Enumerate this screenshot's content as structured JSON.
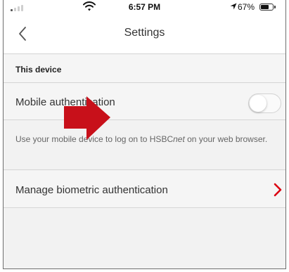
{
  "status_bar": {
    "time": "6:57 PM",
    "battery_pct": "67%",
    "battery_level": 0.67
  },
  "nav": {
    "title": "Settings",
    "back_icon": "chevron-left-icon"
  },
  "section": {
    "title": "This device"
  },
  "mobile_auth": {
    "label": "Mobile authentication",
    "enabled": false,
    "description_prefix": "Use your mobile device to log on to HSBC",
    "description_brand_suffix": "net",
    "description_rest": " on your web browser."
  },
  "biometric": {
    "label": "Manage biometric authentication",
    "chevron_icon": "chevron-right-icon"
  },
  "overlay": {
    "arrow_icon": "red-arrow-icon"
  },
  "colors": {
    "accent_red": "#db0011",
    "arrow_red": "#c8101a",
    "background": "#f2f2f2",
    "text_primary": "#333333",
    "text_secondary": "#666666"
  }
}
